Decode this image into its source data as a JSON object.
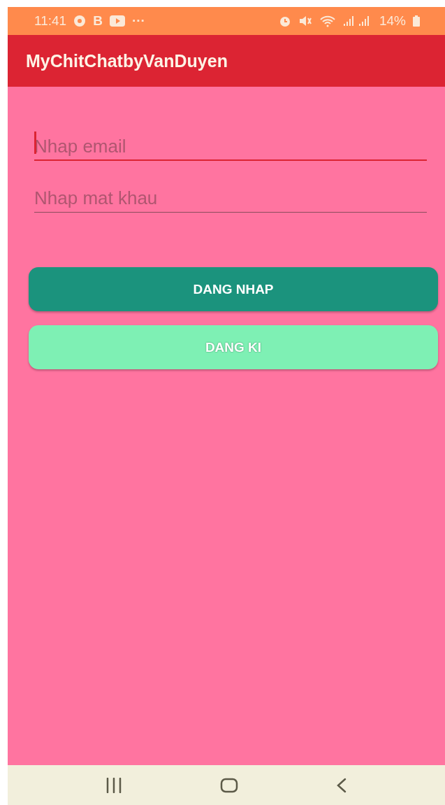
{
  "status_bar": {
    "time": "11:41",
    "app_letter": "B",
    "more": "···",
    "battery": "14%"
  },
  "app_bar": {
    "title": "MyChitChatbyVanDuyen"
  },
  "fields": [
    {
      "placeholder": "Nhap email",
      "focused": true
    },
    {
      "placeholder": "Nhap mat khau",
      "focused": false
    }
  ],
  "buttons": [
    {
      "label": "DANG NHAP",
      "kind": "primary"
    },
    {
      "label": "DANG KI",
      "kind": "secondary"
    }
  ]
}
